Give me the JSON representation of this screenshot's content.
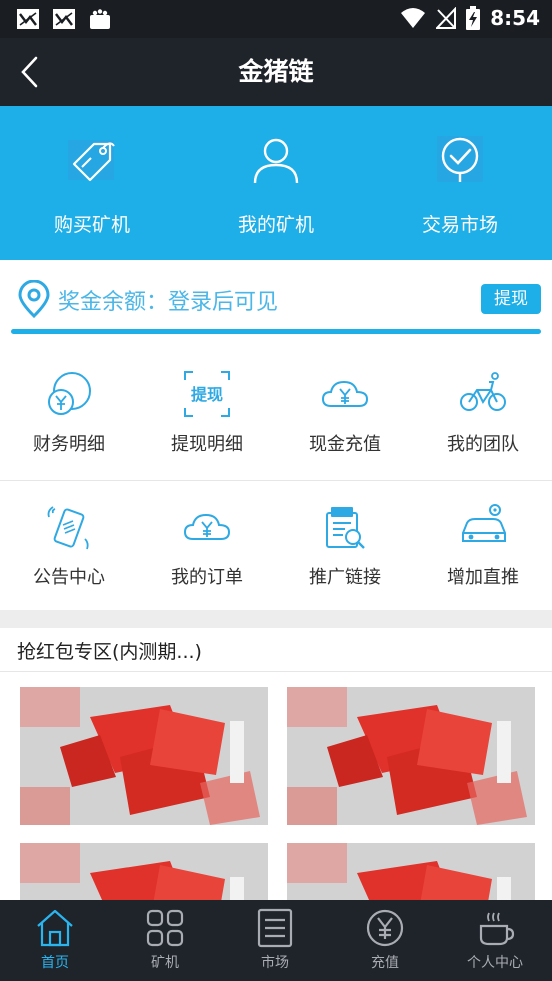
{
  "status_bar": {
    "time": "8:54",
    "icons": [
      "notification-app-icon",
      "notification-app-icon",
      "shopping-bag-icon",
      "wifi-icon",
      "no-signal-icon",
      "battery-charging-icon"
    ]
  },
  "header": {
    "title": "金猪链"
  },
  "features": [
    {
      "label": "购买矿机",
      "icon": "tag-icon"
    },
    {
      "label": "我的矿机",
      "icon": "user-icon"
    },
    {
      "label": "交易市场",
      "icon": "check-pin-icon"
    }
  ],
  "bonus": {
    "text": "奖金余额：登录后可见",
    "withdraw_label": "提现"
  },
  "grid": [
    {
      "label": "财务明细",
      "icon": "finance-icon"
    },
    {
      "label": "提现明细",
      "icon": "withdraw-record-icon",
      "icon_text": "提现"
    },
    {
      "label": "现金充值",
      "icon": "cloud-yuan-icon"
    },
    {
      "label": "我的团队",
      "icon": "bicycle-icon"
    },
    {
      "label": "公告中心",
      "icon": "phone-ring-icon"
    },
    {
      "label": "我的订单",
      "icon": "cloud-yuan-icon"
    },
    {
      "label": "推广链接",
      "icon": "register-search-icon"
    },
    {
      "label": "增加直推",
      "icon": "car-location-icon"
    }
  ],
  "section": {
    "title": "抢红包专区(内测期...)"
  },
  "tabs": [
    {
      "label": "首页",
      "icon": "home-icon",
      "active": true
    },
    {
      "label": "矿机",
      "icon": "grid-icon",
      "active": false
    },
    {
      "label": "市场",
      "icon": "list-icon",
      "active": false
    },
    {
      "label": "充值",
      "icon": "yuan-coin-icon",
      "active": false
    },
    {
      "label": "个人中心",
      "icon": "coffee-cup-icon",
      "active": false
    }
  ],
  "colors": {
    "accent": "#1eaee8",
    "header_bg": "#1f232a",
    "status_bg": "#1a1d22",
    "tab_active": "#2bb5ef",
    "tab_inactive": "#a9adb3"
  }
}
